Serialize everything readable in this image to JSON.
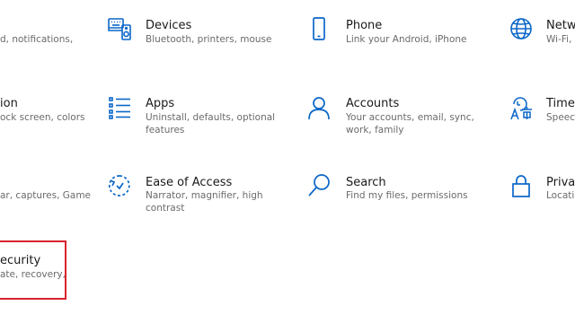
{
  "accent_color": "#0a66c8",
  "highlight_color": "#d9232d",
  "tiles": {
    "system": {
      "title": "",
      "desc": [
        "d, notifications,"
      ]
    },
    "devices": {
      "title": "Devices",
      "desc": [
        "Bluetooth, printers, mouse"
      ],
      "icon": "keyboard-speaker-icon"
    },
    "phone": {
      "title": "Phone",
      "desc": [
        "Link your Android, iPhone"
      ],
      "icon": "phone-icon"
    },
    "network": {
      "title": "Netwo",
      "desc": [
        "Wi-Fi, a"
      ],
      "icon": "globe-icon"
    },
    "personalization": {
      "title": "ion",
      "desc": [
        "ock screen, colors"
      ]
    },
    "apps": {
      "title": "Apps",
      "desc": [
        "Uninstall, defaults, optional",
        "features"
      ],
      "icon": "apps-list-icon"
    },
    "accounts": {
      "title": "Accounts",
      "desc": [
        "Your accounts, email, sync,",
        "work, family"
      ],
      "icon": "person-icon"
    },
    "time_language": {
      "title": "Time &",
      "desc": [
        "Speech"
      ],
      "icon": "language-icon"
    },
    "gaming": {
      "title": "",
      "desc": [
        "ar, captures, Game"
      ]
    },
    "ease_of_access": {
      "title": "Ease of Access",
      "desc": [
        "Narrator, magnifier, high",
        "contrast"
      ],
      "icon": "ease-of-access-icon"
    },
    "search": {
      "title": "Search",
      "desc": [
        "Find my files, permissions"
      ],
      "icon": "search-icon"
    },
    "privacy": {
      "title": "Privacy",
      "desc": [
        "Location"
      ],
      "icon": "lock-icon"
    },
    "update_security": {
      "title": "ecurity",
      "desc": [
        "ate, recovery,"
      ]
    }
  }
}
